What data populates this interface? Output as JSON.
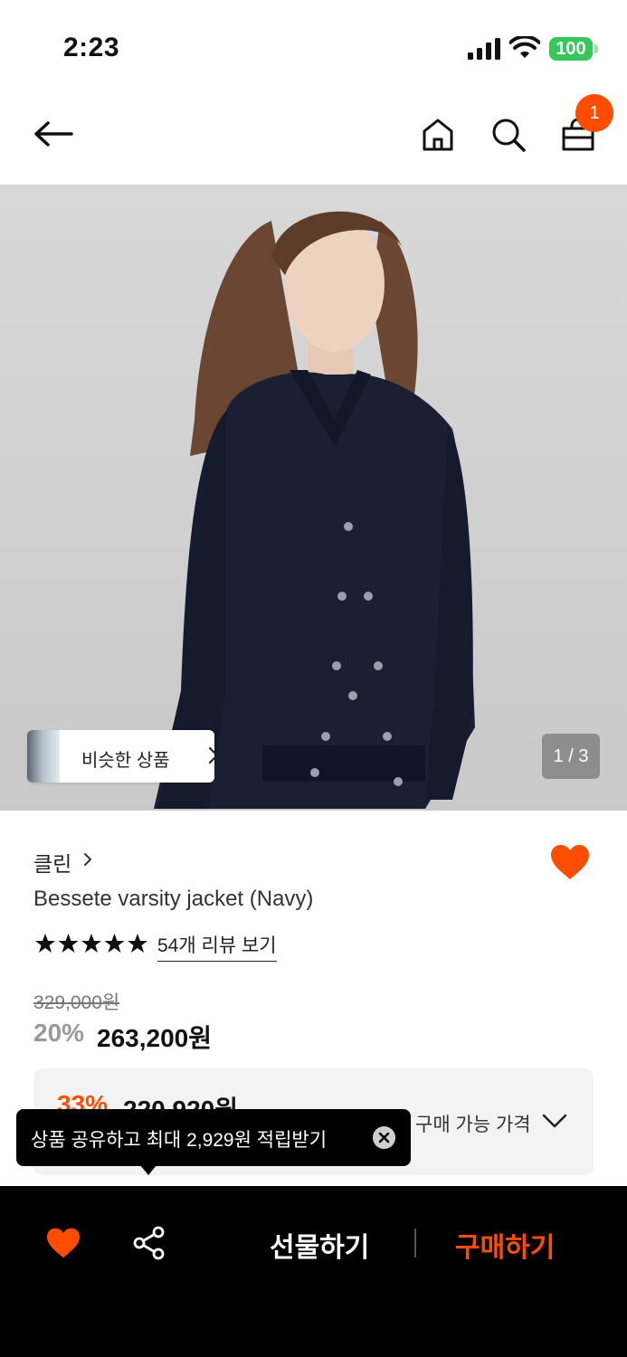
{
  "status_bar": {
    "time": "2:23",
    "battery": "100"
  },
  "header": {
    "cart_count": "1"
  },
  "hero": {
    "similar_label": "비슷한 상품",
    "page_indicator": "1 / 3"
  },
  "product": {
    "brand": "클린",
    "name": "Bessete varsity jacket (Navy)",
    "rating_stars": 5,
    "review_link": "54개 리뷰 보기",
    "original_price": "329,000원",
    "discount_rate": "20%",
    "price": "263,200원"
  },
  "coupon": {
    "discount_rate": "33%",
    "price": "220,920원",
    "label": "구매 가능 가격"
  },
  "tooltip": {
    "text": "상품 공유하고 최대 2,929원 적립받기"
  },
  "bottom_bar": {
    "gift_label": "선물하기",
    "buy_label": "구매하기"
  },
  "colors": {
    "accent": "#ff4d00",
    "black": "#000000",
    "panel": "#f3f3f3"
  },
  "icons": [
    "back-arrow-icon",
    "home-icon",
    "search-icon",
    "cart-icon",
    "chevron-right-icon",
    "heart-icon",
    "star-icon",
    "chevron-down-icon",
    "close-icon",
    "share-icon"
  ]
}
